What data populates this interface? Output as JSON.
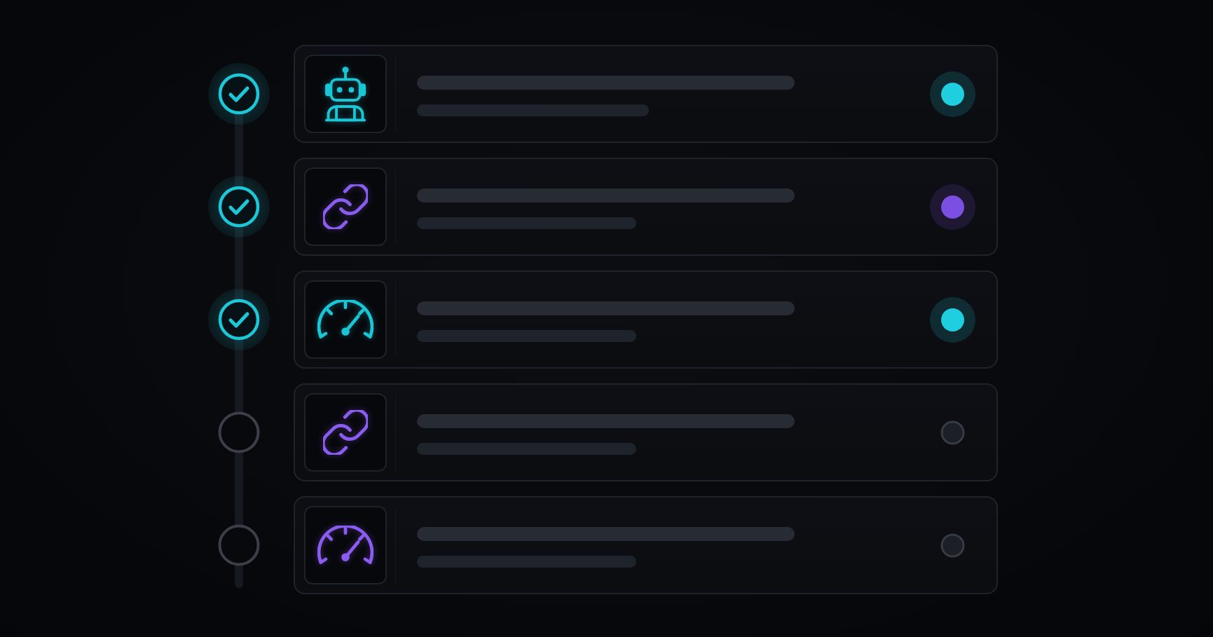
{
  "steps": [
    {
      "done": true,
      "icon": {
        "kind": "robot",
        "color": "#19c6d6"
      },
      "status": {
        "on": true,
        "color": "#1fcfe0"
      }
    },
    {
      "done": true,
      "icon": {
        "kind": "link",
        "color": "#8b5cf0"
      },
      "status": {
        "on": true,
        "color": "#7c4fe3"
      }
    },
    {
      "done": true,
      "icon": {
        "kind": "gauge",
        "color": "#19c6d6"
      },
      "status": {
        "on": true,
        "color": "#1fcfe0"
      }
    },
    {
      "done": false,
      "icon": {
        "kind": "link",
        "color": "#8b5cf0"
      },
      "status": {
        "on": false,
        "color": "#1c1f26"
      }
    },
    {
      "done": false,
      "icon": {
        "kind": "gauge",
        "color": "#8b5cf0"
      },
      "status": {
        "on": false,
        "color": "#1c1f26"
      }
    }
  ]
}
